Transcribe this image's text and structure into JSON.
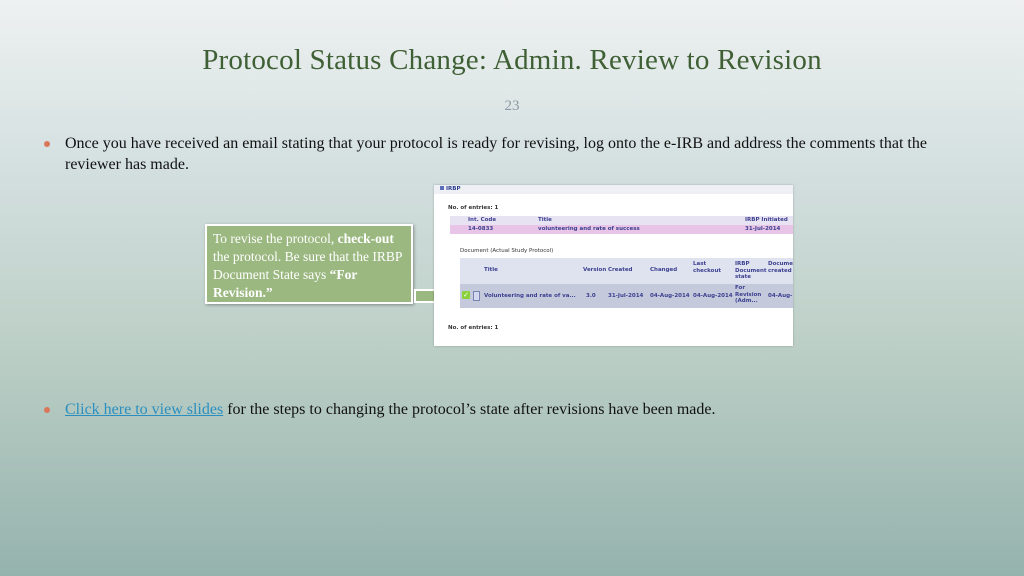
{
  "slide": {
    "title": "Protocol Status Change: Admin. Review to Revision",
    "number": "23"
  },
  "bullets": {
    "first": "Once you have received an email stating that your protocol is ready for revising, log onto the e-IRB and address the comments that the reviewer has made.",
    "second_link": "Click here to view slides",
    "second_rest": " for the steps to changing the protocol’s state after revisions have been made."
  },
  "callout": {
    "part1": "To revise the protocol, ",
    "bold1": "check-out",
    "part2": " the protocol. Be sure that the IRBP Document State says ",
    "bold2": "“For Revision.”"
  },
  "screenshot": {
    "header": "IRBP",
    "entries_top": "No. of entries: 1",
    "protocol_table": {
      "headers": [
        "Int. Code",
        "Title",
        "IRBP Initiated"
      ],
      "row": [
        "14-0833",
        "volunteering and rate of success",
        "31-Jul-2014"
      ]
    },
    "document_label": "Document (Actual Study Protocol)",
    "document_table": {
      "headers": [
        "Title",
        "Version",
        "Created",
        "Changed",
        "Last checkout",
        "IRBP Document state",
        "Docume created"
      ],
      "row": [
        "Volunteering and rate of va...",
        "3.0",
        "31-Jul-2014",
        "04-Aug-2014",
        "04-Aug-2014",
        "For Revision (Adm...",
        "04-Aug-"
      ]
    },
    "entries_bottom": "No. of entries: 1"
  },
  "colors": {
    "title": "#3f5f35",
    "callout_bg": "#9bb880",
    "bullet_dot": "#d9775a",
    "link": "#2a8fc0"
  }
}
